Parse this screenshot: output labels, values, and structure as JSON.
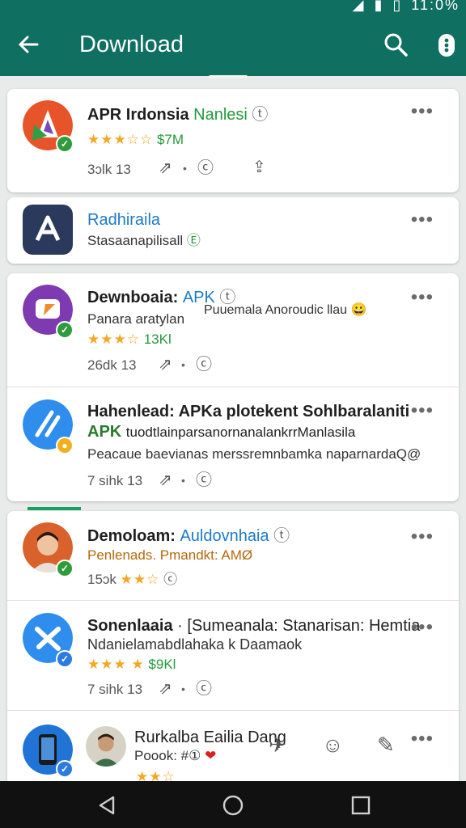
{
  "status_bar": {
    "time": "11:0%",
    "icons": [
      "signal-icon",
      "wifi-icon",
      "battery-icon"
    ]
  },
  "app_bar": {
    "title": "Download",
    "back_icon": "arrow-left-icon",
    "search_icon": "search-icon",
    "menu_icon": "overflow-menu-icon",
    "background": "#0f6f61"
  },
  "items": [
    {
      "title": "APR Irdonsia",
      "tag": "Nanlesi",
      "tag_icon": "ⓣ",
      "rating_stars": "★★★☆☆",
      "rating_label": "$7M",
      "counts": "3ɔlk 13",
      "menu": "•••"
    },
    {
      "title": "Radhiraila",
      "subtitle": "Stasaanapilisall",
      "subtitle_icon": "Ⓔ",
      "menu": "•••"
    },
    {
      "title": "Dewnboaia:",
      "tag": "APK",
      "tag_icon": "ⓣ",
      "floating_text": "Puuemala Anoroudic llau 😀",
      "subtitle": "Panara aratylan",
      "rating_stars": "★★★☆",
      "rating_label": "13Kl",
      "counts": "26dk 13",
      "menu": "•••"
    },
    {
      "title": "Hahenlead: APKa plotekent Sohlbaralaniti",
      "line2_tag": "APK",
      "line2": "tuodtlainparsanornanalankrrManlasila",
      "line3": "Peacaue baevianas merssremnbamka naparnardaQ@",
      "counts": "7 sihk 13",
      "menu": "•••"
    },
    {
      "title": "Demoloam:",
      "tag": "Auldovnhaia",
      "tag_icon": "ⓣ",
      "subtitle": "Penlenads. Pmandkt: AMØ",
      "counts": "15ɔk",
      "rating_stars": "★★☆",
      "menu": "•••"
    },
    {
      "title": "Sonenlaaia",
      "title_rest": "· [Sumeanala: Stanarisan: Hemtia",
      "line2": "Ndanielamabdlahaka k Daamaok",
      "rating_stars": "★★★ ★",
      "rating_label": "$9Kl",
      "counts": "7 sihk 13",
      "menu": "•••"
    },
    {
      "title": "Rurkalba Eailia Dang",
      "subtitle": "Poook: #①",
      "heart": "❤",
      "menu": "•••"
    }
  ],
  "nav": {
    "back": "nav-back-icon",
    "home": "nav-home-icon",
    "recents": "nav-recents-icon"
  }
}
